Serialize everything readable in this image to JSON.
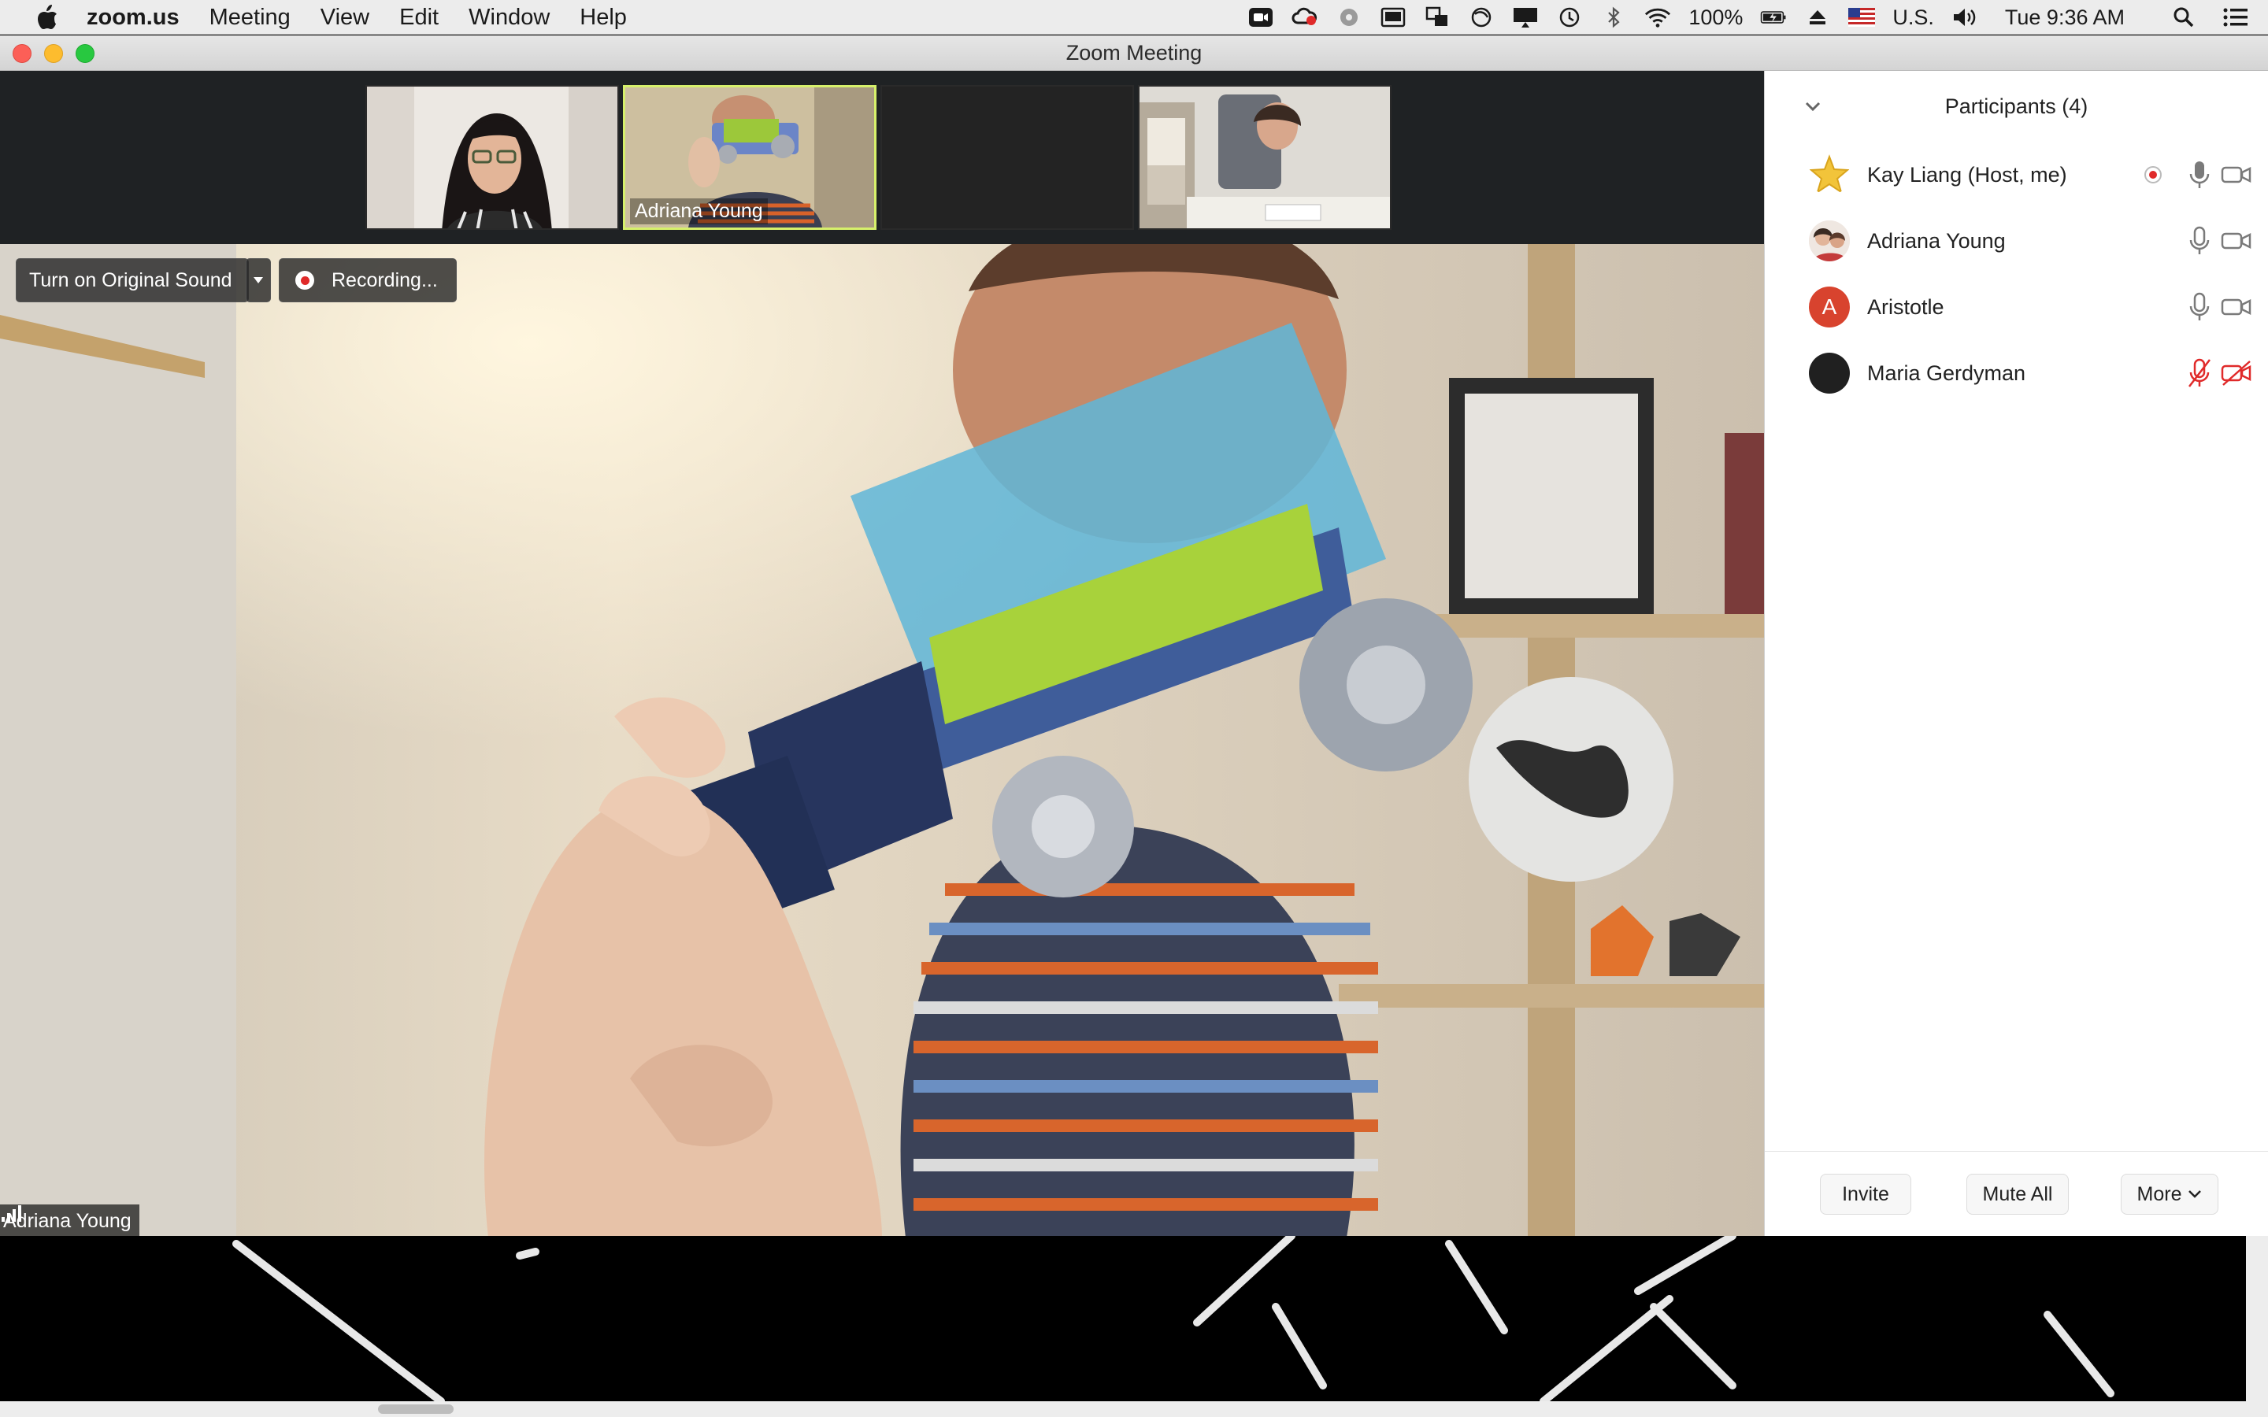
{
  "menubar": {
    "app": "zoom.us",
    "items": [
      "Meeting",
      "View",
      "Edit",
      "Window",
      "Help"
    ],
    "battery": "100%",
    "input_source": "U.S.",
    "clock": "Tue 9:36 AM"
  },
  "window": {
    "title": "Zoom Meeting"
  },
  "thumbnails": [
    {
      "name": "",
      "active": false
    },
    {
      "name": "Adriana Young",
      "active": true
    },
    {
      "name": "",
      "active": false
    },
    {
      "name": "",
      "active": false
    }
  ],
  "speaker": {
    "original_sound_label": "Turn on Original Sound",
    "recording_label": "Recording...",
    "name": "Adriana Young"
  },
  "participants": {
    "title": "Participants (4)",
    "list": [
      {
        "name": "Kay Liang (Host, me)",
        "avatar": "star-avatar",
        "recording": true,
        "mic_muted": false,
        "video_off": false
      },
      {
        "name": "Adriana Young",
        "avatar": "photo-avatar",
        "recording": false,
        "mic_muted": false,
        "video_off": false
      },
      {
        "name": "Aristotle",
        "avatar": "letter-avatar",
        "initial": "A",
        "recording": false,
        "mic_muted": false,
        "video_off": false
      },
      {
        "name": "Maria Gerdyman",
        "avatar": "dark-avatar",
        "recording": false,
        "mic_muted": true,
        "video_off": true
      }
    ],
    "invite_label": "Invite",
    "mute_all_label": "Mute All",
    "more_label": "More"
  },
  "colors": {
    "active_border": "#d6f06b",
    "muted_red": "#e02a2a",
    "aristotle_avatar": "#d8432e",
    "recording_dot": "#e02a2a"
  }
}
